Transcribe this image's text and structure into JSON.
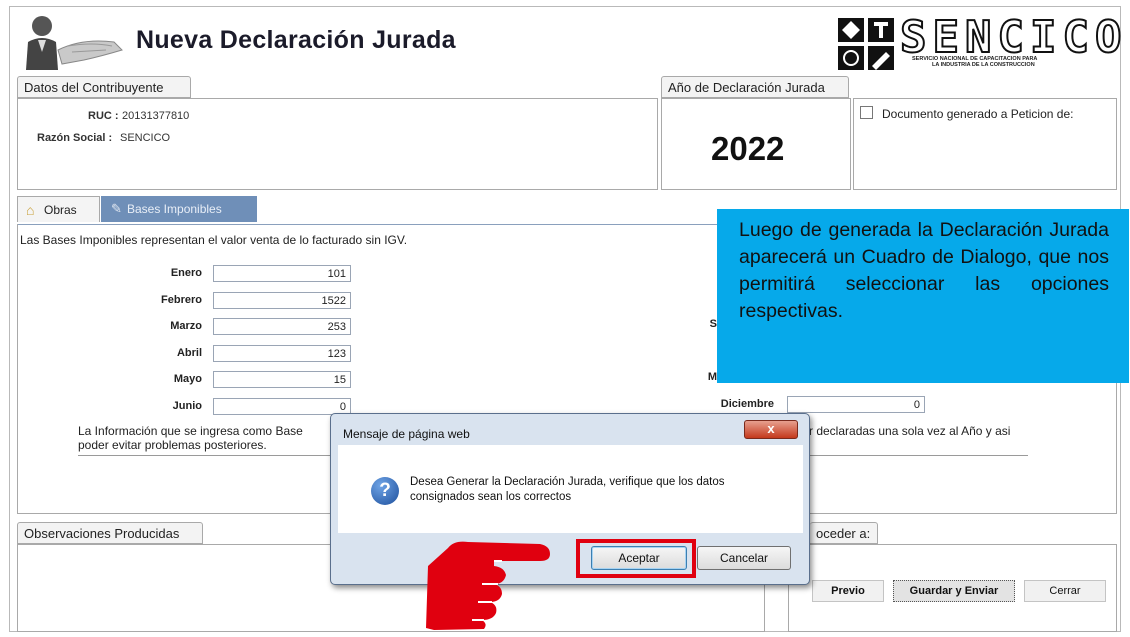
{
  "header": {
    "title": "Nueva Declaración Jurada",
    "logo": {
      "text": "SENCICO",
      "subtitle_line1": "SERVICIO NACIONAL DE CAPACITACION PARA",
      "subtitle_line2": "LA INDUSTRIA DE LA CONSTRUCCION"
    }
  },
  "contributor": {
    "panel_label": "Datos del Contribuyente",
    "ruc_label": "RUC :",
    "ruc_value": "20131377810",
    "razon_label": "Razón Social :",
    "razon_value": "SENCICO"
  },
  "year_panel": {
    "label": "Año de Declaración Jurada",
    "year": "2022"
  },
  "peticion": {
    "label": "Documento generado a Peticion de:",
    "checked": false
  },
  "tabs": [
    {
      "label": "Obras",
      "icon": "home-icon",
      "active": true
    },
    {
      "label": "Bases Imponibles",
      "icon": "edit-icon",
      "active": false
    }
  ],
  "bases": {
    "description": "Las Bases Imponibles representan el valor venta de lo facturado sin IGV.",
    "months": [
      {
        "label": "Enero",
        "value": "101"
      },
      {
        "label": "Febrero",
        "value": "1522"
      },
      {
        "label": "Marzo",
        "value": "253"
      },
      {
        "label": "Abril",
        "value": "123"
      },
      {
        "label": "Mayo",
        "value": "15"
      },
      {
        "label": "Junio",
        "value": "0"
      }
    ],
    "right_visible": [
      {
        "label": "Diciembre",
        "value": "0"
      }
    ],
    "partial_letters": {
      "s": "S",
      "m": "M"
    },
    "info_line1_start": "La Información que se ingresa como Base",
    "info_line1_end": "r declaradas una sola vez al Año y asi",
    "info_line2": "poder evitar problemas posteriores."
  },
  "observaciones": {
    "label": "Observaciones Producidas"
  },
  "proceder": {
    "label": "oceder a:",
    "buttons": [
      "Previo",
      "Guardar y Enviar",
      "Cerrar"
    ]
  },
  "callout": {
    "text": "Luego de generada la Declaración Jurada aparecerá un Cuadro de Dialogo, que nos permitirá seleccionar las opciones respectivas."
  },
  "dialog": {
    "title": "Mensaje de página web",
    "message_line1": "Desea Generar la Declaración Jurada, verifique que los datos",
    "message_line2": "consignados sean los correctos",
    "ok_label": "Aceptar",
    "cancel_label": "Cancelar",
    "close_glyph": "x"
  },
  "colors": {
    "callout_bg": "#06a9ea",
    "highlight_red": "#e0000f",
    "tab_active_bg": "#6f8fb8"
  }
}
